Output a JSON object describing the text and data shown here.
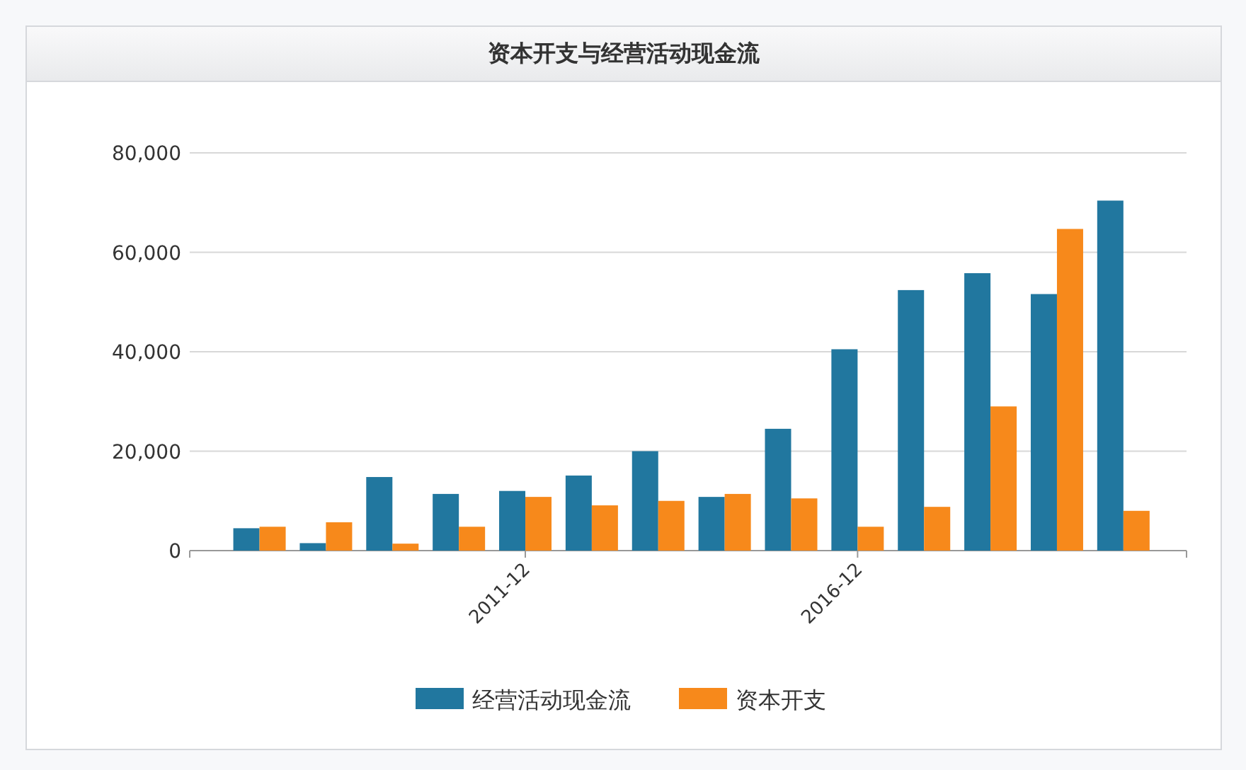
{
  "panel": {
    "title": "资本开支与经营活动现金流",
    "chart_data": {
      "type": "bar",
      "categories": [
        null,
        null,
        null,
        null,
        "2011-12",
        null,
        null,
        null,
        null,
        "2016-12",
        null,
        null,
        null,
        null
      ],
      "ylim": [
        0,
        80000
      ],
      "grid": true,
      "legend": "bottom",
      "yticks": [
        {
          "value": 0,
          "label": "0"
        },
        {
          "value": 20000,
          "label": "20,000"
        },
        {
          "value": 40000,
          "label": "40,000"
        },
        {
          "value": 60000,
          "label": "60,000"
        },
        {
          "value": 80000,
          "label": "80,000"
        }
      ],
      "series": [
        {
          "name": "经营活动现金流",
          "color": "#21779f",
          "values": [
            4500,
            1500,
            14800,
            11400,
            12000,
            15100,
            20000,
            10800,
            24500,
            40500,
            52400,
            55800,
            51600,
            70400
          ]
        },
        {
          "name": "资本开支",
          "color": "#f7891b",
          "values": [
            4800,
            5700,
            1400,
            4800,
            10800,
            9100,
            10000,
            11400,
            10500,
            4800,
            8800,
            29000,
            64700,
            8000
          ]
        }
      ]
    }
  }
}
